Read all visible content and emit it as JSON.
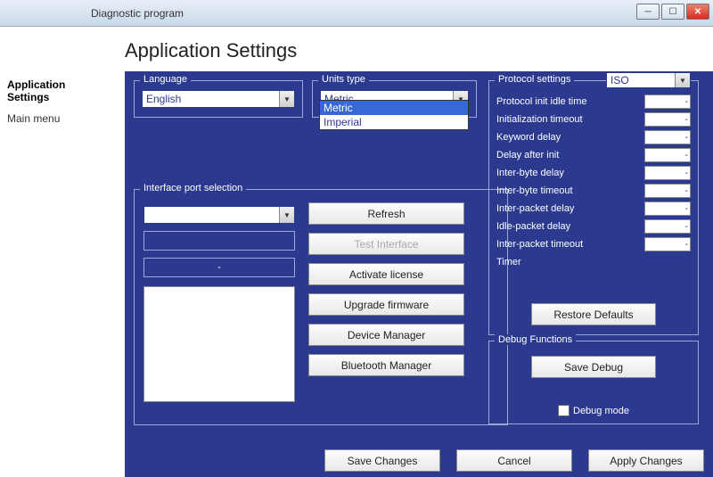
{
  "window": {
    "title": "Diagnostic program"
  },
  "page": {
    "title": "Application Settings"
  },
  "nav": {
    "item1": "Application Settings",
    "item2": "Main menu"
  },
  "language": {
    "legend": "Language",
    "value": "English"
  },
  "units": {
    "legend": "Units type",
    "value": "Metric",
    "options": {
      "opt1": "Metric",
      "opt2": "Imperial"
    }
  },
  "port": {
    "legend": "Interface port selection",
    "dash": "-",
    "buttons": {
      "refresh": "Refresh",
      "test": "Test Interface",
      "activate": "Activate license",
      "upgrade": "Upgrade firmware",
      "device": "Device Manager",
      "bluetooth": "Bluetooth Manager"
    }
  },
  "protocol": {
    "legend": "Protocol settings",
    "value": "ISO",
    "labels": {
      "r1": "Protocol init idle time",
      "r2": "Initialization timeout",
      "r3": "Keyword delay",
      "r4": "Delay after init",
      "r5": "Inter-byte delay",
      "r6": "Inter-byte timeout",
      "r7": "Inter-packet delay",
      "r8": "Idle-packet delay",
      "r9": "Inter-packet timeout",
      "r10": "Timer"
    },
    "vals": {
      "v1": "-",
      "v2": "-",
      "v3": "-",
      "v4": "-",
      "v5": "-",
      "v6": "-",
      "v7": "-",
      "v8": "-",
      "v9": "-"
    },
    "restore": "Restore Defaults"
  },
  "debug": {
    "legend": "Debug Functions",
    "save": "Save Debug",
    "mode": "Debug mode"
  },
  "footer": {
    "save": "Save Changes",
    "cancel": "Cancel",
    "apply": "Apply Changes"
  }
}
